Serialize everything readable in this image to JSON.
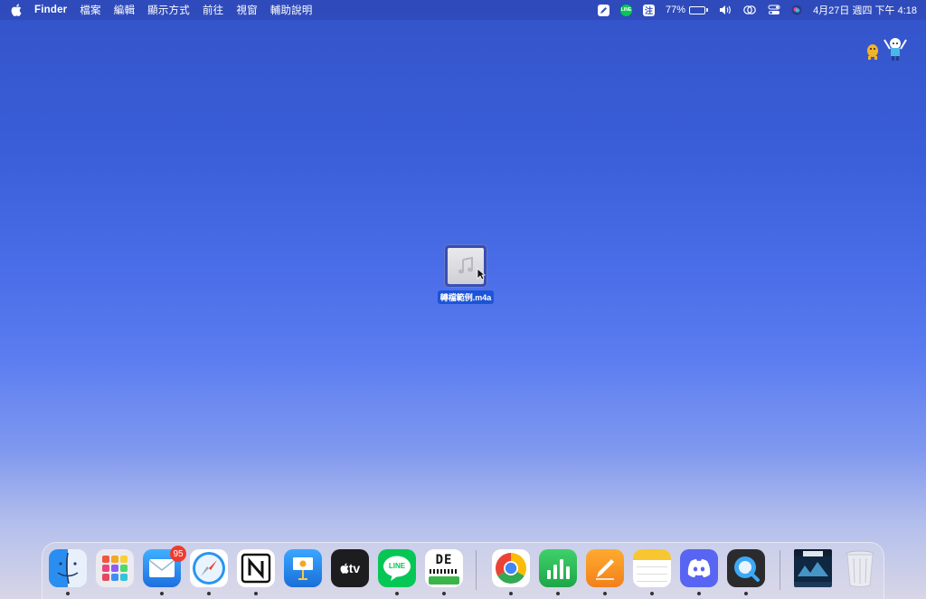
{
  "menubar": {
    "apple_icon": "apple-logo-icon",
    "app_name": "Finder",
    "menus": [
      "檔案",
      "編輯",
      "顯示方式",
      "前往",
      "視窗",
      "輔助說明"
    ],
    "status": {
      "input_method_label": "注",
      "line_label": "LINE",
      "battery_percent": "77%",
      "battery_level": 0.77,
      "clock": "4月27日 週四 下午 4:18"
    }
  },
  "desktop": {
    "file_name": "轉檔範例.m4a",
    "file_icon": "music-note-icon"
  },
  "dock": {
    "apps": [
      {
        "name": "Finder",
        "icon": "finder-icon",
        "running": true
      },
      {
        "name": "Launchpad",
        "icon": "launchpad-icon",
        "running": false
      },
      {
        "name": "Mail",
        "icon": "mail-icon",
        "running": true,
        "badge": "95"
      },
      {
        "name": "Safari",
        "icon": "safari-icon",
        "running": true
      },
      {
        "name": "Notion",
        "icon": "notion-icon",
        "running": true
      },
      {
        "name": "Keynote",
        "icon": "keynote-icon",
        "running": false
      },
      {
        "name": "Apple TV",
        "icon": "apple-tv-icon",
        "running": false,
        "label": "tv"
      },
      {
        "name": "LINE",
        "icon": "line-icon",
        "running": true,
        "label": "LINE"
      },
      {
        "name": "MyCoach",
        "icon": "mycoach-icon",
        "running": true,
        "label": "DE"
      },
      {
        "name": "Google Chrome",
        "icon": "chrome-icon",
        "running": true
      },
      {
        "name": "Numbers",
        "icon": "numbers-icon",
        "running": true
      },
      {
        "name": "Pages",
        "icon": "pages-icon",
        "running": true
      },
      {
        "name": "Notes",
        "icon": "notes-icon",
        "running": true
      },
      {
        "name": "Discord",
        "icon": "discord-icon",
        "running": true
      },
      {
        "name": "QuickTime Player",
        "icon": "quicktime-icon",
        "running": true
      },
      {
        "name": "Downloads",
        "icon": "downloads-stack-icon",
        "running": false
      },
      {
        "name": "Trash",
        "icon": "trash-icon",
        "running": false
      }
    ]
  }
}
